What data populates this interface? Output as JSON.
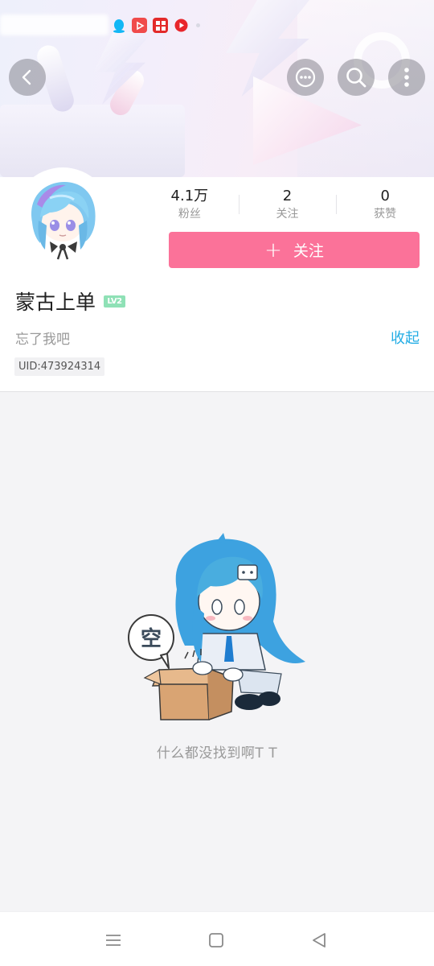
{
  "header": {
    "status_icons": [
      "qq-icon",
      "video-icon",
      "game-icon",
      "youtube-icon"
    ],
    "back_icon": "chevron-left-icon",
    "actions": [
      "message-icon",
      "search-icon",
      "more-vertical-icon"
    ]
  },
  "profile": {
    "stats": [
      {
        "value": "4.1万",
        "label": "粉丝"
      },
      {
        "value": "2",
        "label": "关注"
      },
      {
        "value": "0",
        "label": "获赞"
      }
    ],
    "follow_button": {
      "icon": "+",
      "label": "关注"
    },
    "username": "蒙古上单",
    "level": "LV2",
    "bio": "忘了我吧",
    "collapse_label": "收起",
    "uid": "UID:473924314"
  },
  "empty_state": {
    "bubble_text": "空",
    "message": "什么都没找到啊T T"
  },
  "colors": {
    "accent_pink": "#fb7299",
    "link_blue": "#23ade5",
    "level_green": "#8fe1b6"
  }
}
